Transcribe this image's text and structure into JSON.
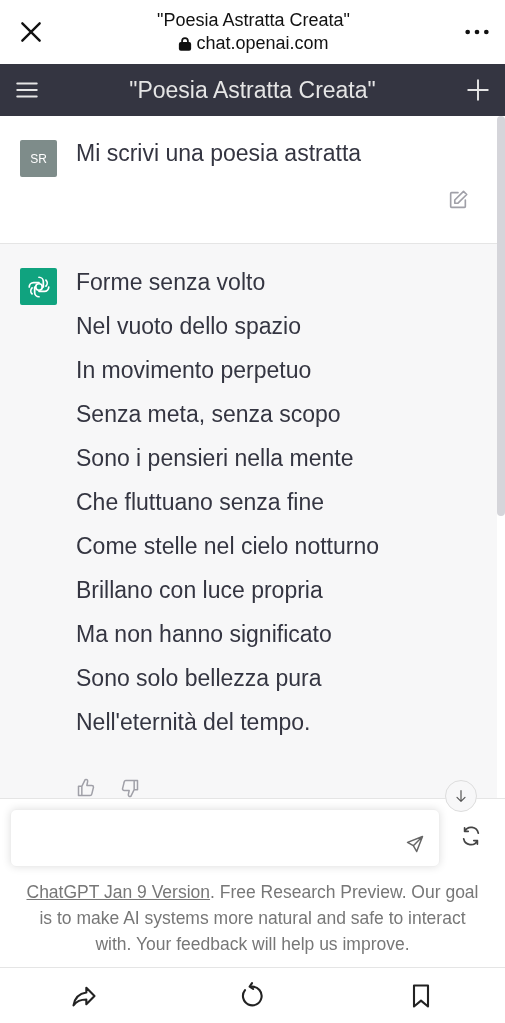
{
  "browser_bar": {
    "page_title": "\"Poesia Astratta Creata\"",
    "url": "chat.openai.com"
  },
  "app_header": {
    "title": "\"Poesia Astratta Creata\""
  },
  "messages": [
    {
      "kind": "user",
      "avatar": "SR",
      "lines": [
        "Mi scrivi una poesia astratta"
      ]
    },
    {
      "kind": "assistant",
      "lines": [
        "Forme senza volto",
        "Nel vuoto dello spazio",
        "In movimento perpetuo",
        "Senza meta, senza scopo",
        "Sono i pensieri nella mente",
        "Che fluttuano senza fine",
        "Come stelle nel cielo notturno",
        "Brillano con luce propria",
        "Ma non hanno significato",
        "Sono solo bellezza pura",
        "Nell'eternità del tempo."
      ]
    }
  ],
  "footer": {
    "link": "ChatGPT Jan 9 Version",
    "text": ". Free Research Preview. Our goal is to make AI systems more natural and safe to interact with. Your feedback will help us improve."
  }
}
